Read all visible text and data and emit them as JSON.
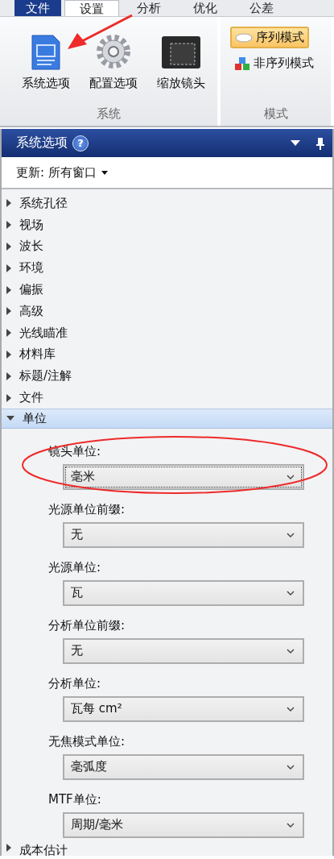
{
  "tabs": [
    {
      "label": "文件",
      "kind": "app",
      "selected": false
    },
    {
      "label": "设置",
      "kind": "tab",
      "selected": true
    },
    {
      "label": "分析",
      "kind": "tab",
      "selected": false
    },
    {
      "label": "优化",
      "kind": "tab",
      "selected": false
    },
    {
      "label": "公差",
      "kind": "tab",
      "selected": false
    }
  ],
  "ribbon": {
    "groups": [
      {
        "label": "系统",
        "kind": "large",
        "buttons": [
          {
            "label": "系统选项"
          },
          {
            "label": "配置选项"
          },
          {
            "label": "缩放镜头"
          }
        ]
      },
      {
        "label": "模式",
        "kind": "small",
        "buttons": [
          {
            "label": "序列模式",
            "selected": true
          },
          {
            "label": "非序列模式",
            "selected": false
          }
        ]
      }
    ]
  },
  "panel": {
    "title": "系统选项",
    "help": "?",
    "update": "更新: 所有窗口",
    "tree": [
      {
        "label": "系统孔径",
        "expanded": false
      },
      {
        "label": "视场",
        "expanded": false
      },
      {
        "label": "波长",
        "expanded": false
      },
      {
        "label": "环境",
        "expanded": false
      },
      {
        "label": "偏振",
        "expanded": false
      },
      {
        "label": "高级",
        "expanded": false
      },
      {
        "label": "光线瞄准",
        "expanded": false
      },
      {
        "label": "材料库",
        "expanded": false
      },
      {
        "label": "标题/注解",
        "expanded": false
      },
      {
        "label": "文件",
        "expanded": false
      },
      {
        "label": "单位",
        "expanded": true,
        "fields": [
          {
            "label": "镜头单位:",
            "value": "毫米",
            "focused": true
          },
          {
            "label": "光源单位前缀:",
            "value": "无",
            "focused": false
          },
          {
            "label": "光源单位:",
            "value": "瓦",
            "focused": false
          },
          {
            "label": "分析单位前缀:",
            "value": "无",
            "focused": false
          },
          {
            "label": "分析单位:",
            "value": "瓦每 cm²",
            "focused": false
          },
          {
            "label": "无焦模式单位:",
            "value": "毫弧度",
            "focused": false
          },
          {
            "label": "MTF单位:",
            "value": "周期/毫米",
            "focused": false
          }
        ]
      },
      {
        "label": "成本估计",
        "expanded": false
      }
    ]
  }
}
